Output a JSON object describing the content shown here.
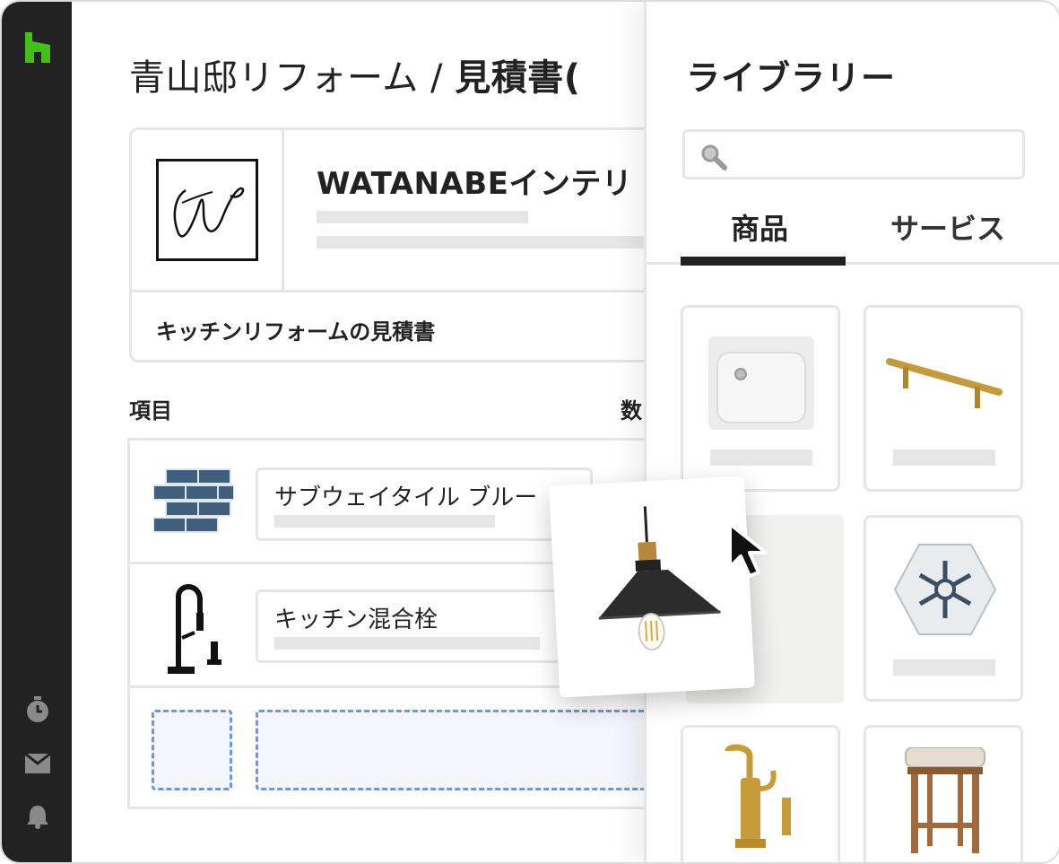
{
  "app": {
    "title_regular": "青山邸リフォーム / ",
    "title_bold": "見積書(",
    "brand_color": "#43c016",
    "sidebar_icons": [
      "home-logo-icon",
      "stopwatch-icon",
      "inbox-icon",
      "bell-icon"
    ]
  },
  "estimate": {
    "company_name": "WATANABEインテリ",
    "logo_monogram": "W",
    "subtitle": "キッチンリフォームの見積書"
  },
  "table": {
    "headers": [
      "項目",
      "数"
    ],
    "rows": [
      {
        "name": "サブウェイタイル ブルー",
        "icon": "subway-tile-icon"
      },
      {
        "name": "キッチン混合栓",
        "icon": "kitchen-faucet-icon"
      }
    ],
    "drop_placeholder": true
  },
  "library": {
    "title": "ライブラリー",
    "search_icon": "search-icon",
    "tabs": [
      {
        "label": "商品",
        "active": true
      },
      {
        "label": "サービス",
        "active": false
      }
    ],
    "items": [
      "sink-icon",
      "cabinet-handle-icon",
      "pendant-lamp-placeholder",
      "hex-tile-icon",
      "gold-faucet-icon",
      "bar-stool-icon"
    ]
  },
  "dragging": {
    "item_icon": "pendant-lamp-icon"
  }
}
